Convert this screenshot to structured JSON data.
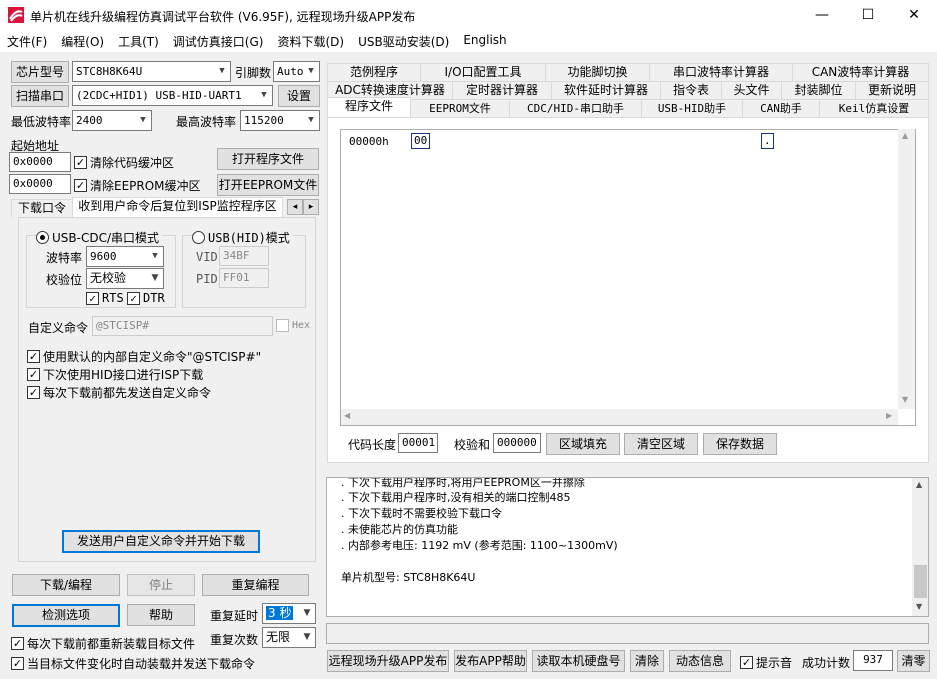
{
  "title": "单片机在线升级编程仿真调试平台软件 (V6.95F), 远程现场升级APP发布",
  "window_controls": {
    "minimize": "—",
    "maximize": "☐",
    "close": "✕"
  },
  "menu": [
    "文件(F)",
    "编程(O)",
    "工具(T)",
    "调试仿真接口(G)",
    "资料下载(D)",
    "USB驱动安装(D)",
    "English"
  ],
  "left": {
    "chip_type_btn": "芯片型号",
    "chip_type_value": "STC8H8K64U",
    "pin_label": "引脚数",
    "pin_value": "Auto",
    "scan_port_btn": "扫描串口",
    "port_value": "(2CDC+HID1) USB-HID-UART1",
    "settings_btn": "设置",
    "min_baud_label": "最低波特率",
    "min_baud_value": "2400",
    "max_baud_label": "最高波特率",
    "max_baud_value": "115200",
    "start_addr_label": "起始地址",
    "addr1": "0x0000",
    "clear_code_label": "清除代码缓冲区",
    "open_prog_btn": "打开程序文件",
    "addr2": "0x0000",
    "clear_eeprom_label": "清除EEPROM缓冲区",
    "open_eeprom_btn": "打开EEPROM文件",
    "tabs": [
      "下载口令",
      "收到用户命令后复位到ISP监控程序区"
    ],
    "tab_scroll": [
      "◂",
      "▸"
    ],
    "usb_cdc_label": "USB-CDC/串口模式",
    "usb_hid_label": "USB(HID)模式",
    "baud_label": "波特率",
    "baud_value": "9600",
    "parity_label": "校验位",
    "parity_value": "无校验",
    "rts_label": "RTS",
    "dtr_label": "DTR",
    "vid_label": "VID",
    "vid_value": "34BF",
    "pid_label": "PID",
    "pid_value": "FF01",
    "custom_cmd_label": "自定义命令",
    "custom_cmd_value": "@STCISP#",
    "hex_label": "Hex",
    "opt1": "使用默认的内部自定义命令\"@STCISP#\"",
    "opt2": "下次使用HID接口进行ISP下载",
    "opt3": "每次下载前都先发送自定义命令",
    "send_btn": "发送用户自定义命令并开始下载",
    "download_btn": "下载/编程",
    "stop_btn": "停止",
    "reprogram_btn": "重复编程",
    "detect_btn": "检测选项",
    "help_btn": "帮助",
    "repeat_delay_label": "重复延时",
    "repeat_delay_value": "3 秒",
    "repeat_count_label": "重复次数",
    "repeat_count_value": "无限",
    "reload_label": "每次下载前都重新装载目标文件",
    "auto_label": "当目标文件变化时自动装载并发送下载命令"
  },
  "right_tabs": {
    "row1": [
      "范例程序",
      "I/O口配置工具",
      "功能脚切换",
      "串口波特率计算器",
      "CAN波特率计算器"
    ],
    "row2": [
      "ADC转换速度计算器",
      "定时器计算器",
      "软件延时计算器",
      "指令表",
      "头文件",
      "封装脚位",
      "更新说明"
    ],
    "row3": [
      "程序文件",
      "EEPROM文件",
      "CDC/HID-串口助手",
      "USB-HID助手",
      "CAN助手",
      "Keil仿真设置"
    ]
  },
  "hex": {
    "address": "00000h",
    "byte": "00",
    "ascii": "."
  },
  "code_panel": {
    "code_len_label": "代码长度",
    "code_len_value": "00001",
    "checksum_label": "校验和",
    "checksum_value": "000000",
    "fill_btn": "区域填充",
    "clear_btn": "清空区域",
    "save_btn": "保存数据"
  },
  "log_lines": [
    ". 下次下载用户程序时,将用户EEPROM区一并擦除",
    ". 下次下载用户程序时,没有相关的端口控制485",
    ". 下次下载时不需要校验下载口令",
    ". 未使能芯片的仿真功能",
    ". 内部参考电压: 1192 mV (参考范围: 1100~1300mV)",
    "",
    "单片机型号: STC8H8K64U"
  ],
  "bottom": {
    "publish_btn": "远程现场升级APP发布",
    "publish_help_btn": "发布APP帮助",
    "read_disk_btn": "读取本机硬盘号",
    "clear_btn": "清除",
    "dynamic_btn": "动态信息",
    "beep_label": "提示音",
    "success_label": "成功计数",
    "success_value": "937",
    "reset_btn": "清零"
  }
}
